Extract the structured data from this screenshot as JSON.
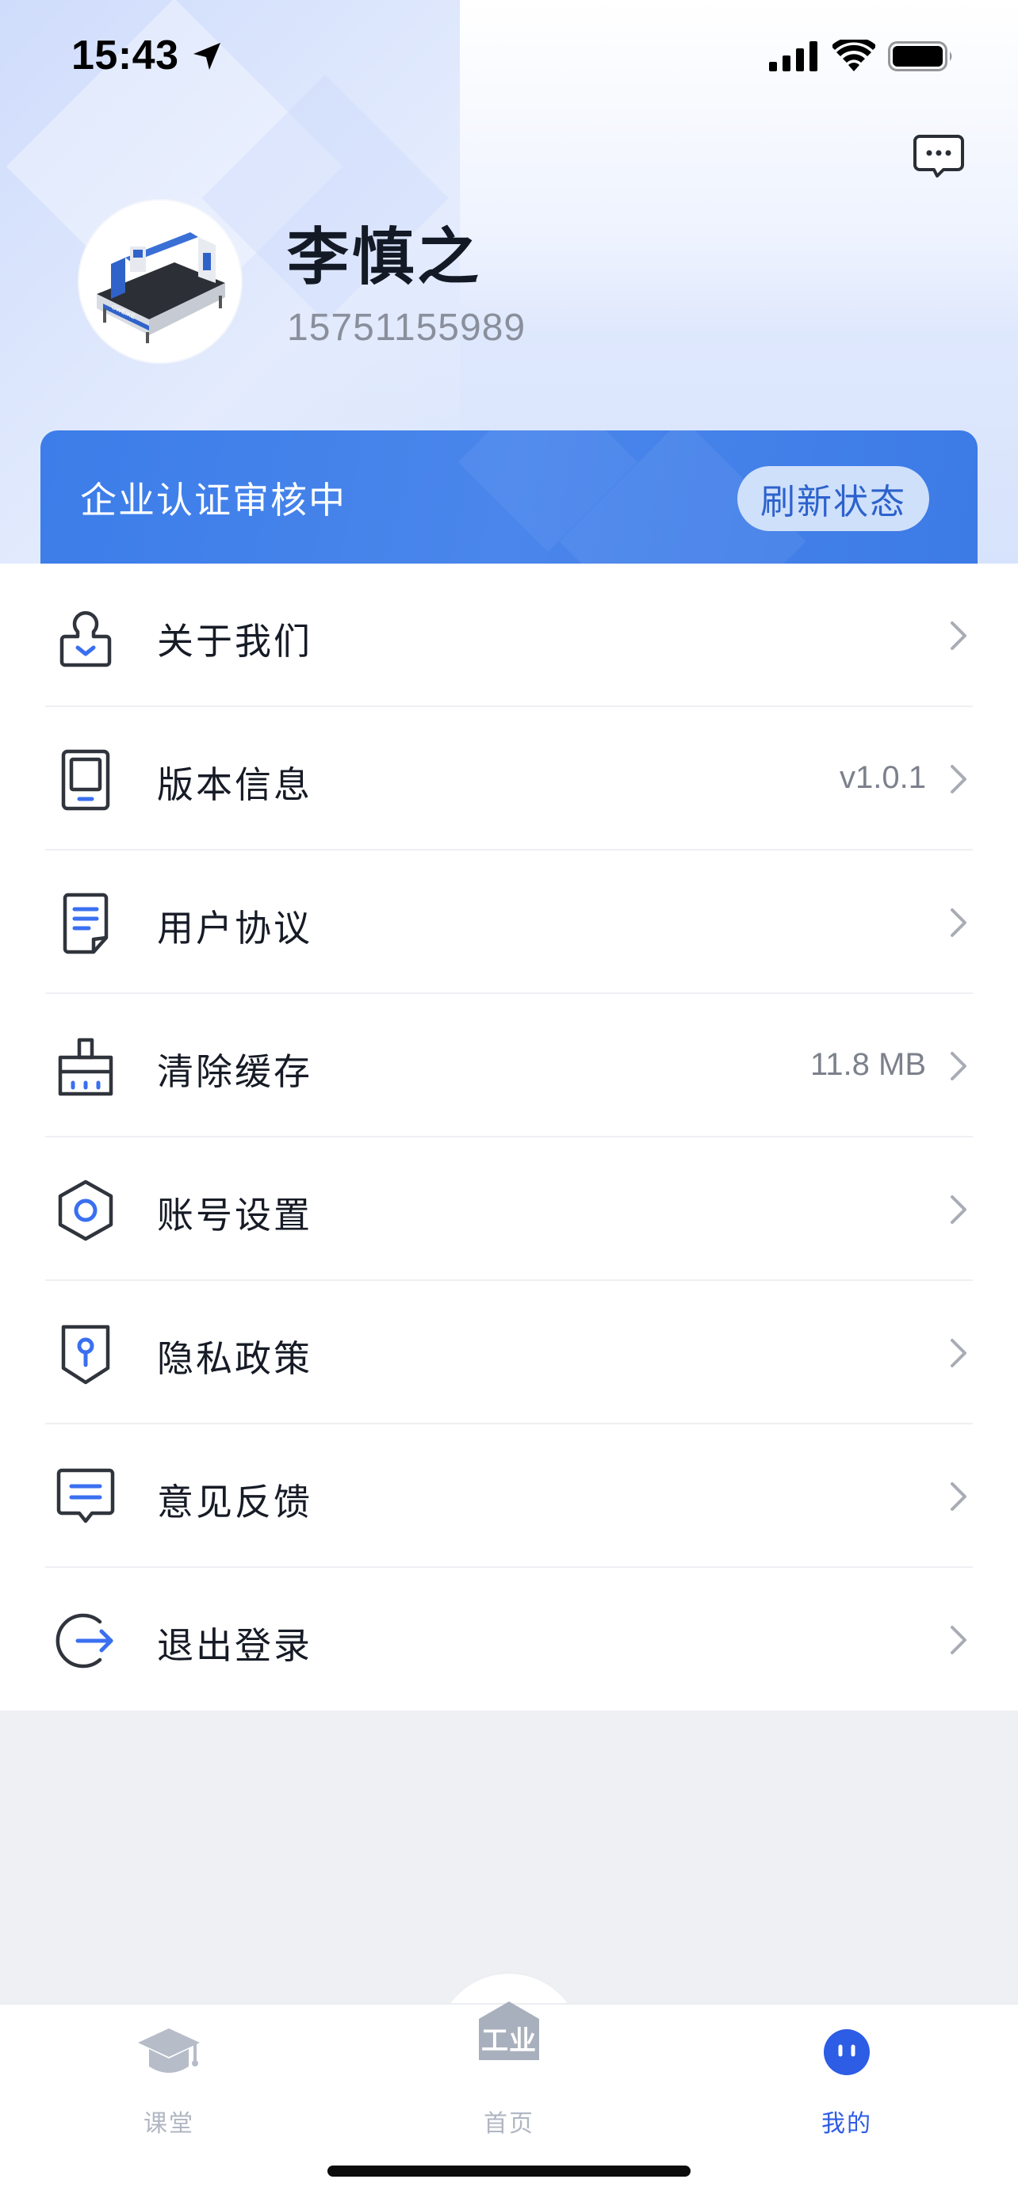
{
  "status_bar": {
    "time": "15:43",
    "icons": [
      "location-arrow-icon",
      "cellular-signal-icon",
      "wifi-icon",
      "battery-icon"
    ]
  },
  "header": {
    "message_icon": "chat-bubble-icon",
    "user": {
      "name": "李慎之",
      "phone": "15751155989",
      "avatar": "laser-cutting-machine-avatar"
    }
  },
  "cert_card": {
    "status_text": "企业认证审核中",
    "refresh_label": "刷新状态"
  },
  "menu": {
    "items": [
      {
        "label": "关于我们",
        "value": "",
        "icon": "about-us-icon"
      },
      {
        "label": "版本信息",
        "value": "v1.0.1",
        "icon": "tablet-icon"
      },
      {
        "label": "用户协议",
        "value": "",
        "icon": "document-icon"
      },
      {
        "label": "清除缓存",
        "value": "11.8 MB",
        "icon": "broom-icon"
      },
      {
        "label": "账号设置",
        "value": "",
        "icon": "hexagon-settings-icon"
      },
      {
        "label": "隐私政策",
        "value": "",
        "icon": "privacy-shield-icon"
      },
      {
        "label": "意见反馈",
        "value": "",
        "icon": "feedback-message-icon"
      },
      {
        "label": "退出登录",
        "value": "",
        "icon": "logout-icon"
      }
    ]
  },
  "tabbar": {
    "tabs": [
      {
        "label": "课堂",
        "icon": "graduation-cap-icon",
        "active": false
      },
      {
        "label": "首页",
        "icon": "industry-home-icon",
        "active": false
      },
      {
        "label": "我的",
        "icon": "profile-face-icon",
        "active": true
      }
    ],
    "home_icon_text": "工业"
  },
  "colors": {
    "accent": "#2d5ce5",
    "card_blue": "#3c7de9",
    "icon_blue": "#3a6ff0",
    "icon_dark": "#30343c",
    "inactive_tab": "#b0b6c2"
  }
}
